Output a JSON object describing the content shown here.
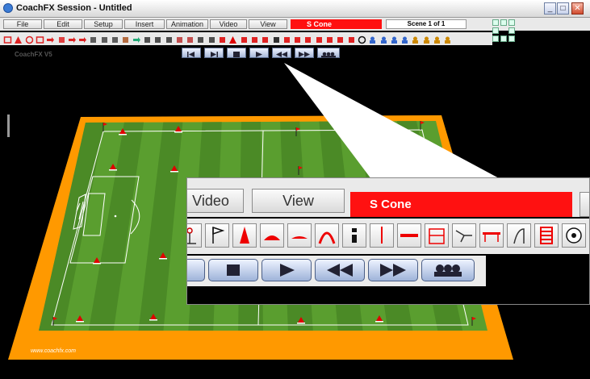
{
  "window": {
    "title": "CoachFX Session - Untitled"
  },
  "menu": {
    "items": [
      "File",
      "Edit",
      "Setup",
      "Insert",
      "Animation",
      "Video",
      "View"
    ],
    "selected_tool": "S Cone",
    "scene": "Scene  1 of 1"
  },
  "canvas": {
    "app_label": "CoachFX V5",
    "website": "www.coachfx.com",
    "colors": {
      "border": "#ff9900",
      "grass_light": "#5a9e2f",
      "grass_dark": "#4b8a26",
      "cone": "#e00000"
    }
  },
  "zoom": {
    "menu_items": [
      "Video",
      "View"
    ],
    "selected_tool": "S Cone"
  },
  "icons": {
    "toolbar": [
      "square-icon",
      "triangle-icon",
      "circle-icon",
      "rect-icon",
      "arrow-icon",
      "dotted-line-icon",
      "dash-arrow-icon",
      "wave-arrow-icon",
      "pen-icon",
      "goal-icon",
      "grid-icon",
      "hurdles-icon",
      "loop-arrow-icon",
      "camera-icon",
      "zoom-in-icon",
      "zoom-out-icon",
      "table-icon",
      "rotate-icon",
      "key-icon",
      "mannequin-icon",
      "flag-icon",
      "cone-icon",
      "disc-icon",
      "dome-icon",
      "arch-icon",
      "dummy-icon",
      "pole-icon",
      "bar-icon",
      "ladder-gate-icon",
      "rebounder-icon",
      "hurdle-icon",
      "mini-hurdle-icon",
      "ladder-icon",
      "ball-icon",
      "player-a1-icon",
      "player-a2-icon",
      "player-a3-icon",
      "player-a4-icon",
      "player-s1-icon",
      "player-s2-icon",
      "player-s3-icon",
      "player-s4-icon"
    ],
    "playback": [
      "skip-start-icon",
      "skip-end-icon",
      "stop-icon",
      "play-icon",
      "rewind-icon",
      "fast-forward-icon",
      "group-icon"
    ]
  }
}
